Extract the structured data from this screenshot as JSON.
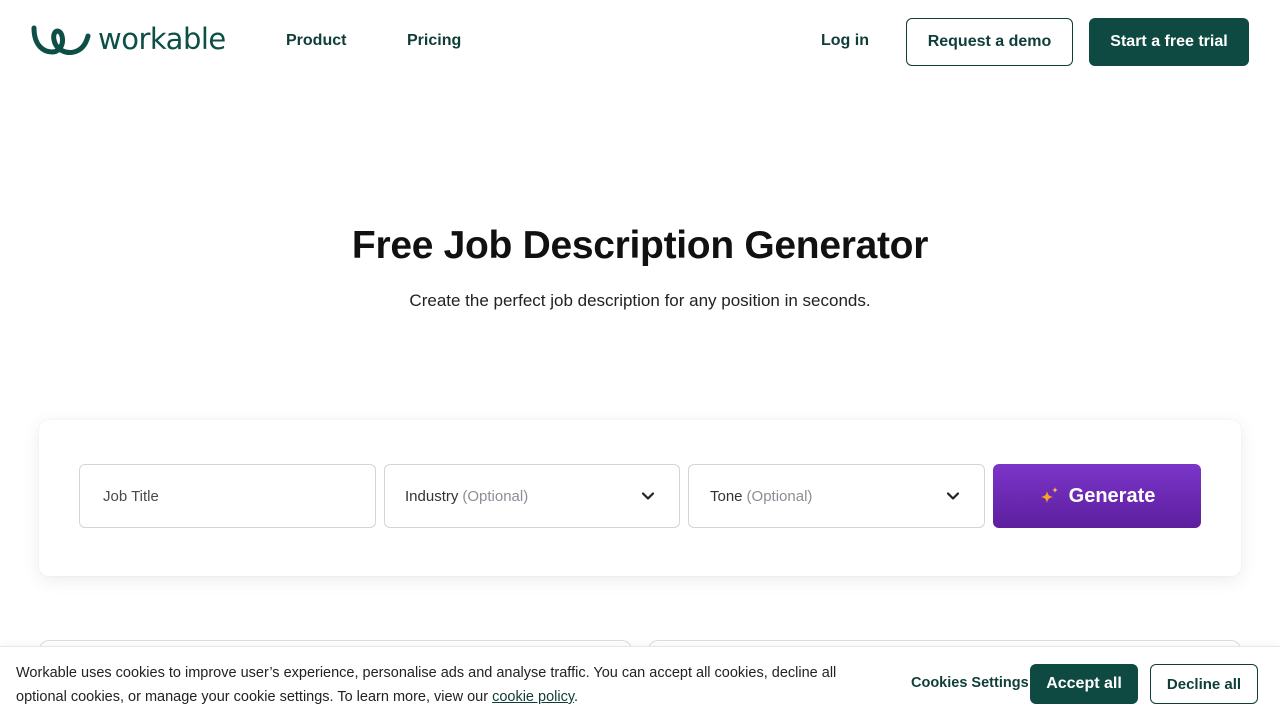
{
  "header": {
    "logo_text": "workable",
    "nav": {
      "product": "Product",
      "pricing": "Pricing",
      "login": "Log in"
    },
    "demo_label": "Request a demo",
    "trial_label": "Start a free trial"
  },
  "hero": {
    "title": "Free Job Description Generator",
    "subtitle": "Create the perfect job description for any position in seconds."
  },
  "form": {
    "job_title_placeholder": "Job Title",
    "industry_label": "Industry",
    "industry_optional": "(Optional)",
    "tone_label": "Tone",
    "tone_optional": "(Optional)",
    "generate_label": "Generate",
    "icons": {
      "sparkle": "sparkle-icon",
      "chevron": "chevron-down-icon"
    }
  },
  "cookie_banner": {
    "text": "Workable uses cookies to improve user’s experience, personalise ads and analyse traffic. You can accept all cookies, decline all optional cookies, or manage your cookie settings. To learn more, view our",
    "link_text": "cookie policy",
    "link_suffix": ".",
    "settings_label": "Cookies Settings",
    "accept_label": "Accept all",
    "decline_label": "Decline all"
  },
  "colors": {
    "brand_dark": "#0f4a42",
    "generate_purple": "#6a28b5",
    "sparkle_orange": "#f5a623"
  }
}
